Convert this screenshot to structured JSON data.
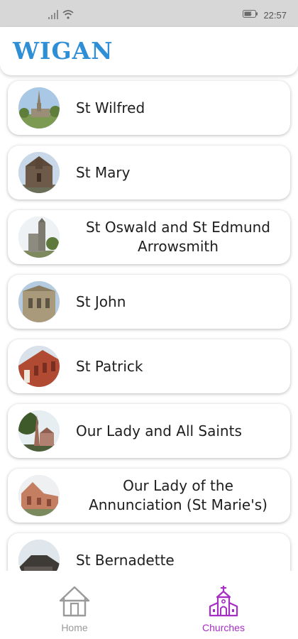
{
  "status_bar": {
    "time": "22:57",
    "icons": [
      "signal-icon",
      "wifi-icon",
      "battery-icon"
    ]
  },
  "header": {
    "logo_text": "WIGAN",
    "logo_color": "#2e8fd6"
  },
  "churches": [
    {
      "name": "St Wilfred"
    },
    {
      "name": "St Mary"
    },
    {
      "name": "St Oswald and St Edmund Arrowsmith"
    },
    {
      "name": "St John"
    },
    {
      "name": "St Patrick"
    },
    {
      "name": "Our Lady and All Saints"
    },
    {
      "name": "Our Lady of the Annunciation (St Marie's)"
    },
    {
      "name": "St Bernadette"
    }
  ],
  "bottom_nav": {
    "items": [
      {
        "label": "Home",
        "icon": "home-icon",
        "active": false
      },
      {
        "label": "Churches",
        "icon": "church-icon",
        "active": true
      }
    ],
    "active_color": "#a62ec4",
    "inactive_color": "#9a9a9a"
  }
}
